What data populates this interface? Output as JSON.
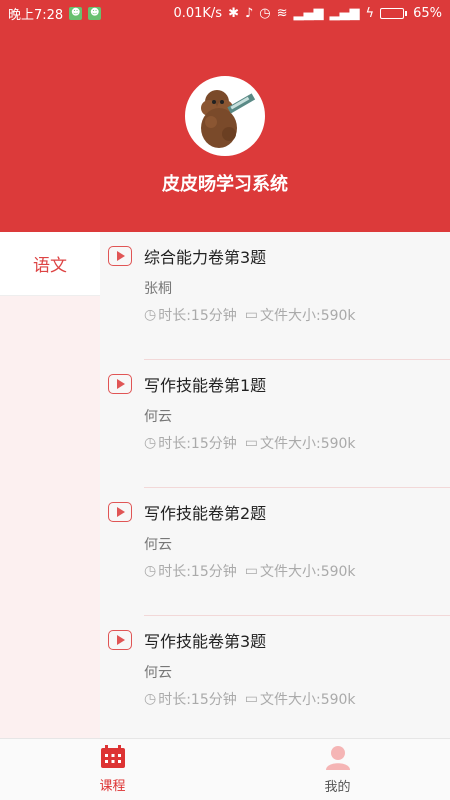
{
  "status_bar": {
    "time": "晚上7:28",
    "network_speed": "0.01K/s",
    "battery_percent": "65%",
    "battery_level": 0.65
  },
  "header": {
    "app_title": "皮皮旸学习系统",
    "background_color": "#dc3a3a"
  },
  "sidebar": {
    "tabs": [
      {
        "label": "语文"
      }
    ]
  },
  "courses": [
    {
      "title": "综合能力卷第3题",
      "author": "张桐",
      "duration": "时长:15分钟",
      "file_size": "文件大小:590k"
    },
    {
      "title": "写作技能卷第1题",
      "author": "何云",
      "duration": "时长:15分钟",
      "file_size": "文件大小:590k"
    },
    {
      "title": "写作技能卷第2题",
      "author": "何云",
      "duration": "时长:15分钟",
      "file_size": "文件大小:590k"
    },
    {
      "title": "写作技能卷第3题",
      "author": "何云",
      "duration": "时长:15分钟",
      "file_size": "文件大小:590k"
    }
  ],
  "bottom_nav": {
    "items": [
      {
        "label": "课程",
        "icon": "calendar-icon",
        "active": true
      },
      {
        "label": "我的",
        "icon": "user-icon",
        "active": false
      }
    ]
  },
  "colors": {
    "accent": "#d33",
    "header": "#dc3a3a",
    "sidebar_bg": "#fcf0f0"
  }
}
